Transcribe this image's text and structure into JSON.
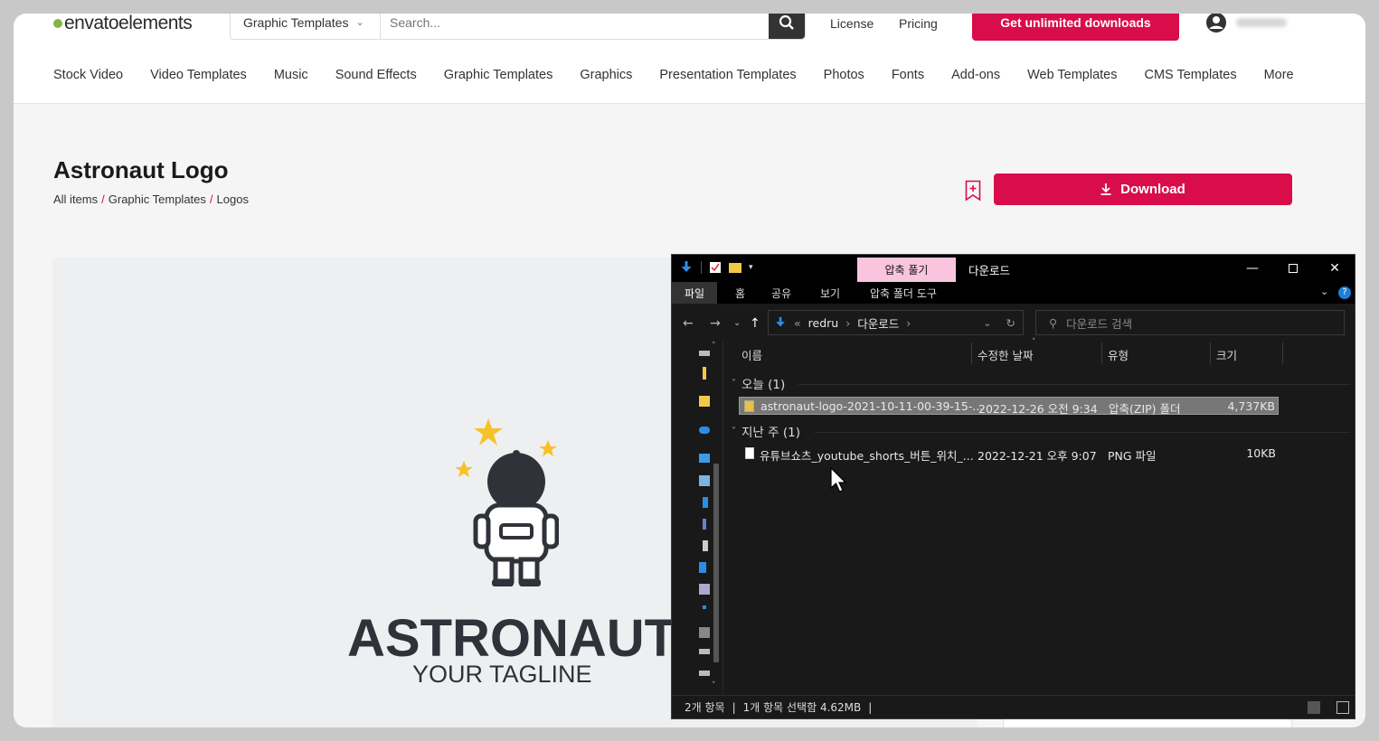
{
  "site": {
    "logo": "envatoelements",
    "search": {
      "category": "Graphic Templates",
      "placeholder": "Search..."
    },
    "top_links": {
      "license": "License",
      "pricing": "Pricing"
    },
    "cta": "Get unlimited downloads",
    "nav": [
      "Stock Video",
      "Video Templates",
      "Music",
      "Sound Effects",
      "Graphic Templates",
      "Graphics",
      "Presentation Templates",
      "Photos",
      "Fonts",
      "Add-ons",
      "Web Templates",
      "CMS Templates",
      "More"
    ]
  },
  "item": {
    "title": "Astronaut Logo",
    "breadcrumb": [
      "All items",
      "Graphic Templates",
      "Logos"
    ],
    "breadcrumb_sep": "/",
    "download_label": "Download",
    "preview_word": "ASTRONAUT",
    "preview_tagline": "YOUR TAGLINE"
  },
  "explorer": {
    "context_tab": "압축 풀기",
    "title": "다운로드",
    "ribbon_tabs": [
      "파일",
      "홈",
      "공유",
      "보기",
      "압축 폴더 도구"
    ],
    "path": [
      "redru",
      "다운로드"
    ],
    "path_prefix": "«",
    "search_placeholder": "다운로드 검색",
    "columns": [
      "이름",
      "수정한 날짜",
      "유형",
      "크기"
    ],
    "groups": [
      {
        "label": "오늘 (1)",
        "files": [
          {
            "name": "astronaut-logo-2021-10-11-00-39-15-...",
            "date": "2022-12-26 오전 9:34",
            "type": "압축(ZIP) 폴더",
            "size": "4,737KB",
            "selected": true
          }
        ]
      },
      {
        "label": "지난 주 (1)",
        "files": [
          {
            "name": "유튜브쇼츠_youtube_shorts_버튼_위치_...",
            "date": "2022-12-21 오후 9:07",
            "type": "PNG 파일",
            "size": "10KB",
            "selected": false
          }
        ]
      }
    ],
    "status": {
      "count": "2개 항목",
      "selection": "1개 항목 선택함 4.62MB",
      "sep": "|"
    }
  },
  "colors": {
    "accent": "#d80d4a",
    "envato_green": "#82b541",
    "context_tab": "#f9c4dd"
  }
}
